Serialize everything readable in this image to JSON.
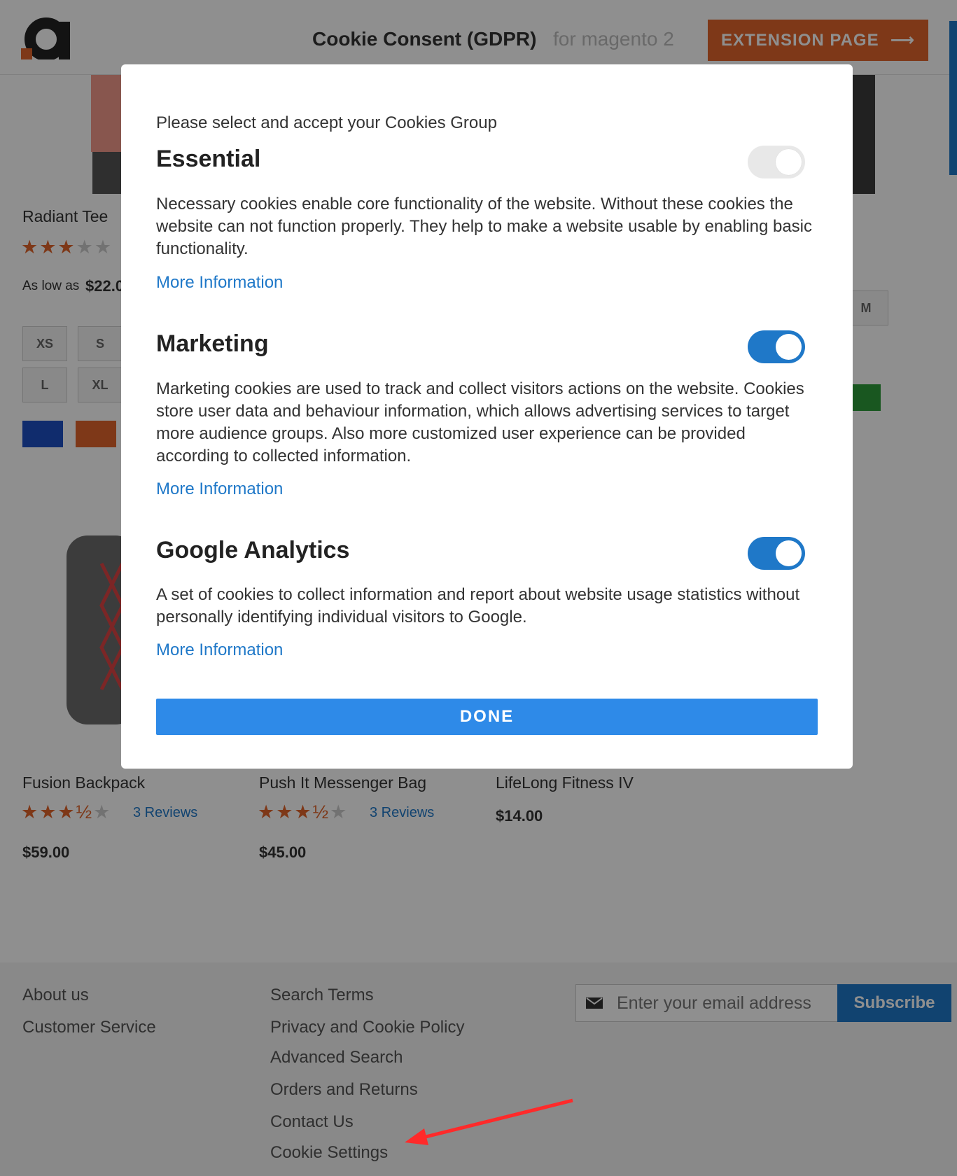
{
  "header": {
    "title": "Cookie Consent (GDPR)",
    "subtitle": "for magento 2",
    "extension_button": "EXTENSION PAGE",
    "brand_color": "#e0652b"
  },
  "products_top": [
    {
      "name": "Radiant Tee",
      "rating": 3,
      "price_prefix": "As low as",
      "price": "$22.0"
    }
  ],
  "sizes": [
    "XS",
    "S",
    "L",
    "XL",
    "M"
  ],
  "swatch_colors": [
    "#1e4fc2",
    "#e0652b",
    "#2e9c3a"
  ],
  "products_bottom": [
    {
      "name": "Fusion Backpack",
      "rating": 3.5,
      "reviews": "3 Reviews",
      "price": "$59.00"
    },
    {
      "name": "Push It Messenger Bag",
      "rating": 3.5,
      "reviews": "3 Reviews",
      "price": "$45.00"
    },
    {
      "name": "LifeLong Fitness IV",
      "price": "$14.00"
    }
  ],
  "footer": {
    "col1": [
      "About us",
      "Customer Service"
    ],
    "col2": [
      "Search Terms",
      "Privacy and Cookie Policy",
      "Advanced Search",
      "Orders and Returns",
      "Contact Us",
      "Cookie Settings"
    ],
    "email_placeholder": "Enter your email address",
    "subscribe_label": "Subscribe"
  },
  "modal": {
    "intro": "Please select and accept your Cookies Group",
    "groups": [
      {
        "title": "Essential",
        "enabled": true,
        "locked": true,
        "description": "Necessary cookies enable core functionality of the website. Without these cookies the website can not function properly. They help to make a website usable by enabling basic functionality.",
        "more": "More Information"
      },
      {
        "title": "Marketing",
        "enabled": true,
        "description": "Marketing cookies are used to track and collect visitors actions on the website. Cookies store user data and behaviour information, which allows advertising services to target more audience groups. Also more customized user experience can be provided according to collected information.",
        "more": "More Information"
      },
      {
        "title": "Google Analytics",
        "enabled": true,
        "description": "A set of cookies to collect information and report about website usage statistics without personally identifying individual visitors to Google.",
        "more": "More Information"
      }
    ],
    "done_label": "DONE",
    "accent_color": "#1f78c8"
  },
  "annotation": {
    "color": "#ff2a2a"
  }
}
